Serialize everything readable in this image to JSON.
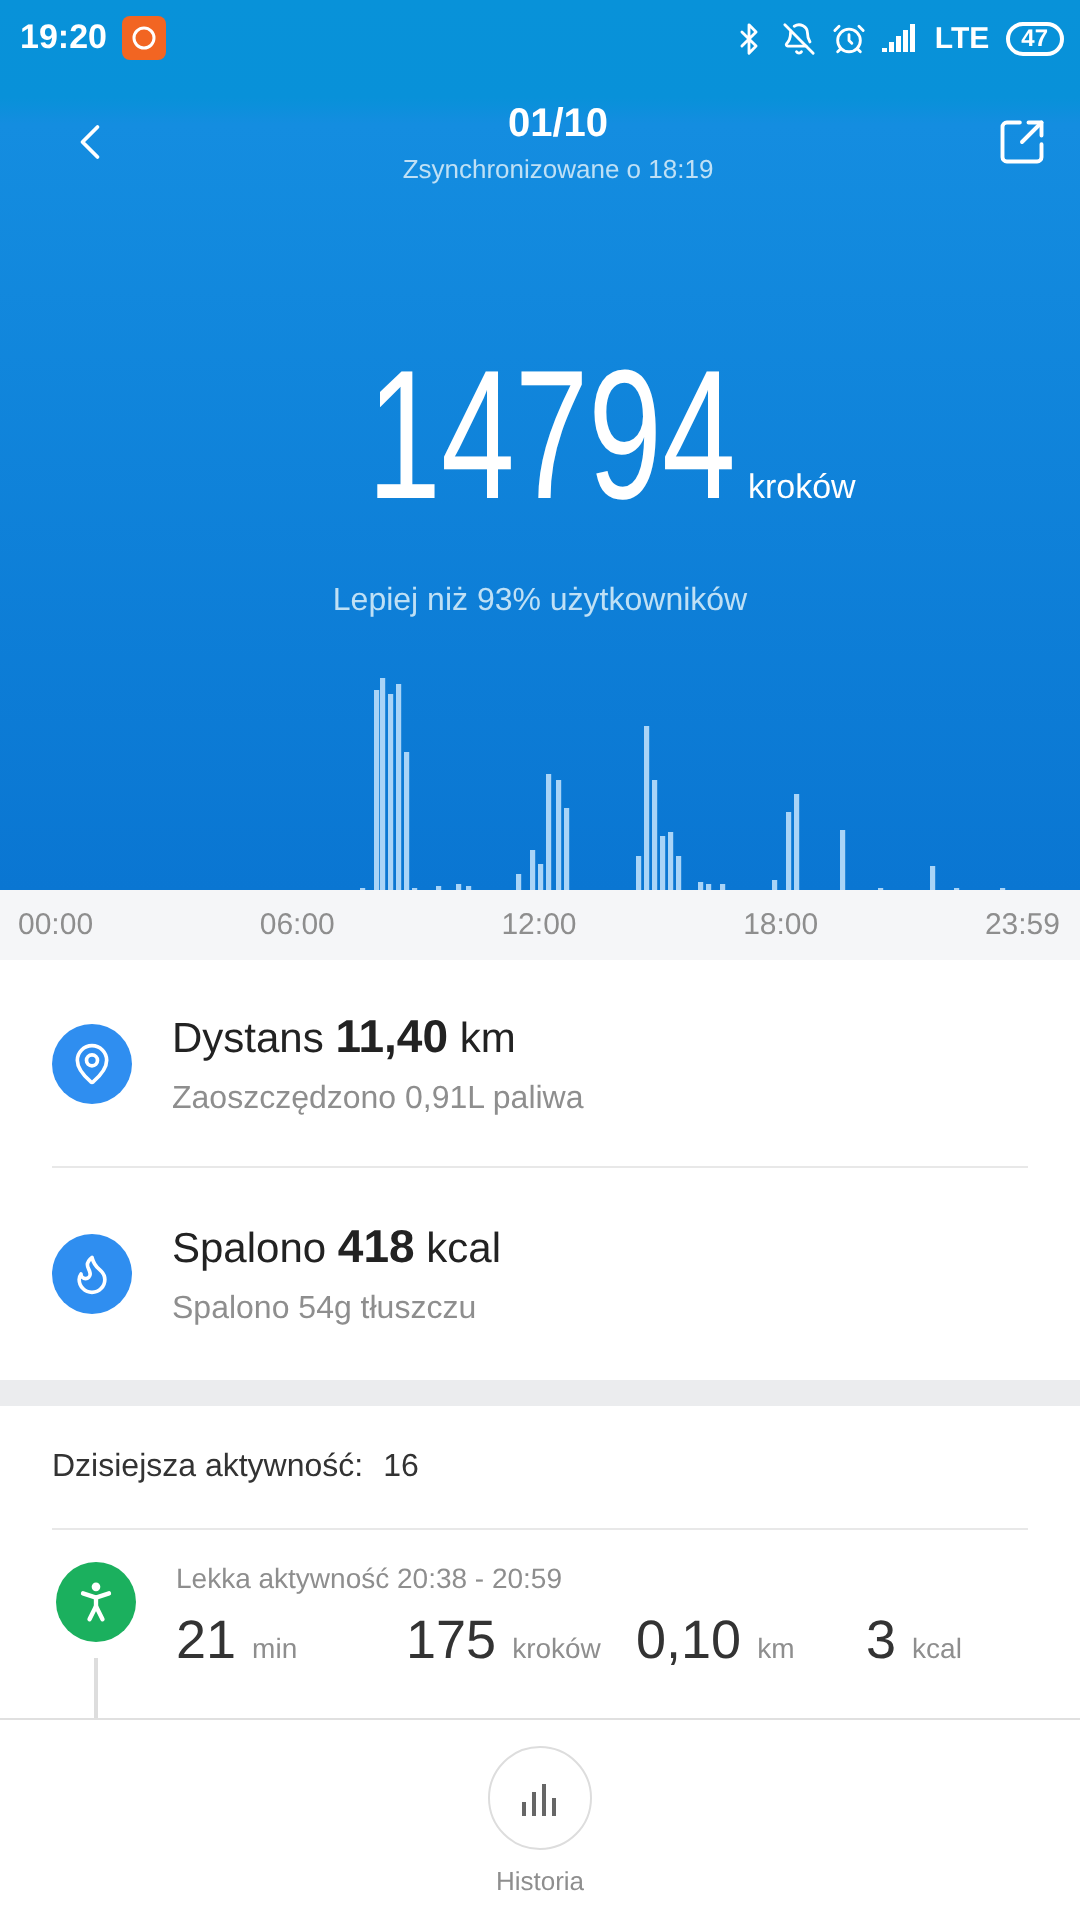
{
  "status_bar": {
    "time": "19:20",
    "network": "LTE",
    "battery": "47"
  },
  "header": {
    "title": "01/10",
    "subtitle": "Zsynchronizowane o 18:19"
  },
  "steps": {
    "count": "14794",
    "unit": "kroków",
    "comparison": "Lepiej niż 93% użytkowników"
  },
  "time_axis": [
    "00:00",
    "06:00",
    "12:00",
    "18:00",
    "23:59"
  ],
  "summary": [
    {
      "kind": "distance",
      "label": "Dystans",
      "value": "11,40",
      "unit": "km",
      "detail": "Zaoszczędzono 0,91L paliwa"
    },
    {
      "kind": "calories",
      "label": "Spalono",
      "value": "418",
      "unit": "kcal",
      "detail": "Spalono 54g tłuszczu"
    }
  ],
  "activity": {
    "label": "Dzisiejsza aktywność:",
    "count": "16",
    "items": [
      {
        "kind": "light",
        "title": "Lekka aktywność 20:38 - 20:59",
        "stats": [
          {
            "value": "21",
            "unit": "min"
          },
          {
            "value": "175",
            "unit": "kroków"
          },
          {
            "value": "0,10",
            "unit": "km"
          },
          {
            "value": "3",
            "unit": "kcal"
          }
        ]
      }
    ]
  },
  "bottom_nav": {
    "label": "Historia"
  }
}
